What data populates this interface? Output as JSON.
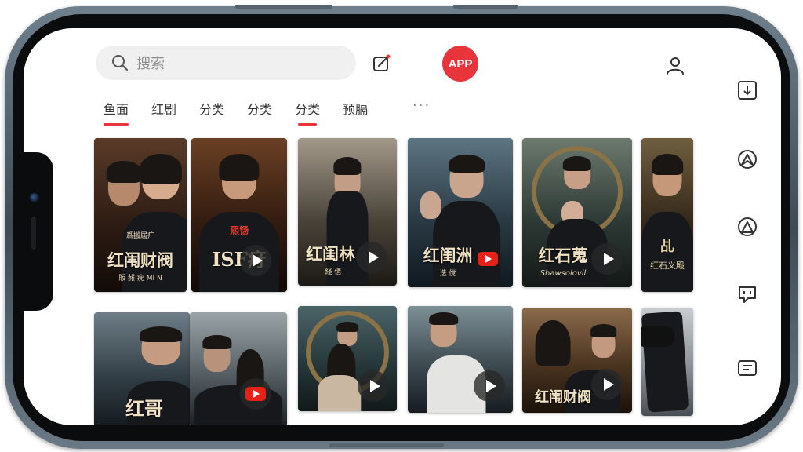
{
  "search": {
    "placeholder": "搜索"
  },
  "header": {
    "app_badge": "APP"
  },
  "tabs": [
    {
      "label": "鱼面"
    },
    {
      "label": "红剧"
    },
    {
      "label": "分类"
    },
    {
      "label": "分类"
    },
    {
      "label": "分类"
    },
    {
      "label": "预膈"
    }
  ],
  "more_label": "···",
  "rail_icons": [
    "download-icon",
    "navigation-icon",
    "navigation-icon",
    "message-icon",
    "list-icon"
  ],
  "colors": {
    "accent": "#e8353c"
  },
  "cards": [
    {
      "title": "红闱财阀",
      "badge": "爲搬屆疒",
      "sub": "販 赧 疣 ΜΙ Ν",
      "play": "none"
    },
    {
      "title": "ISF疛",
      "badge": "熙钖",
      "sub": "",
      "play": "play"
    },
    {
      "title": "红闺林",
      "badge": "",
      "sub": "経 僐",
      "play": "play"
    },
    {
      "title": "红闺洲",
      "badge": "",
      "sub": "迭 傥",
      "play": "youtube"
    },
    {
      "title": "红石蒐",
      "badge": "",
      "sub": "Shawsolovil",
      "play": "play"
    },
    {
      "title": "红石义殿",
      "badge": "乩",
      "sub": "",
      "play": "none"
    },
    {
      "title": "红哥",
      "badge": "",
      "sub": "",
      "play": "none"
    },
    {
      "title": "",
      "badge": "",
      "sub": "",
      "play": "youtube"
    },
    {
      "title": "",
      "badge": "",
      "sub": "",
      "play": "play"
    },
    {
      "title": "",
      "badge": "",
      "sub": "",
      "play": "play"
    },
    {
      "title": "红闱财阀",
      "badge": "",
      "sub": "",
      "play": "play"
    },
    {
      "title": "",
      "badge": "",
      "sub": "",
      "play": "none"
    }
  ]
}
